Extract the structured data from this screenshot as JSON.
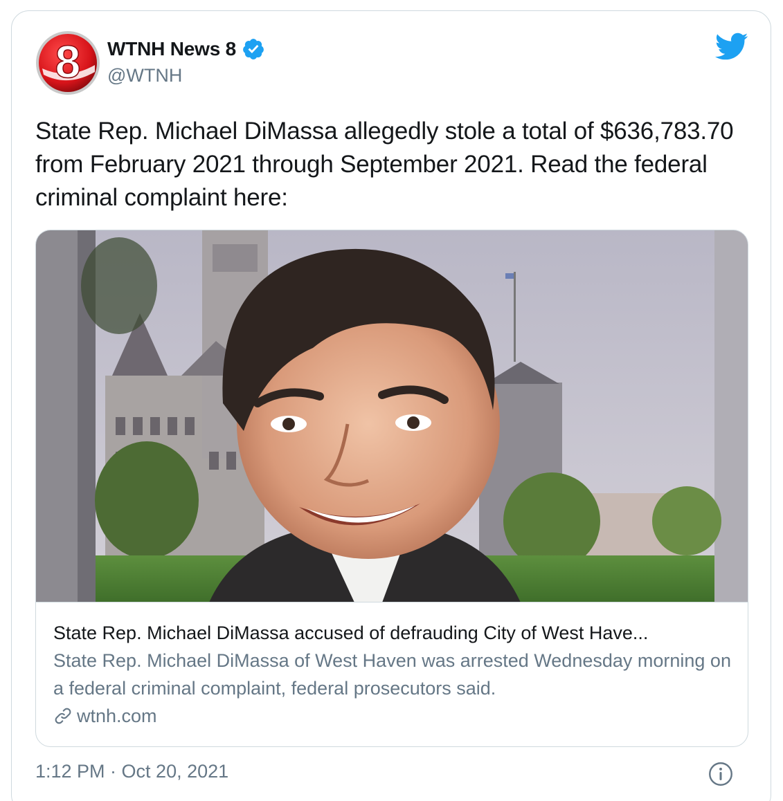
{
  "author": {
    "name": "WTNH News 8",
    "handle": "@WTNH",
    "avatar_icon": "channel-8-logo",
    "avatar_text": "8",
    "verified": true
  },
  "brand_icon": "twitter-bird-icon",
  "tweet": {
    "text": "State Rep. Michael DiMassa allegedly stole a total of $636,783.70 from February 2021 through September 2021. Read the federal criminal complaint here:"
  },
  "link_card": {
    "image_icon": "news-photo",
    "title": "State Rep. Michael DiMassa accused of defrauding City of West Have...",
    "description": "State Rep. Michael DiMassa of West Haven was arrested Wednesday morning on a federal criminal complaint, federal prosecutors said.",
    "domain": "wtnh.com",
    "domain_icon": "link-icon"
  },
  "footer": {
    "timestamp": "1:12 PM · Oct 20, 2021",
    "info_icon": "info-icon"
  },
  "colors": {
    "twitter_blue": "#1da1f2",
    "text_primary": "#14171a",
    "text_secondary": "#657786",
    "border": "#cfd9de",
    "logo_red": "#d7141a"
  }
}
